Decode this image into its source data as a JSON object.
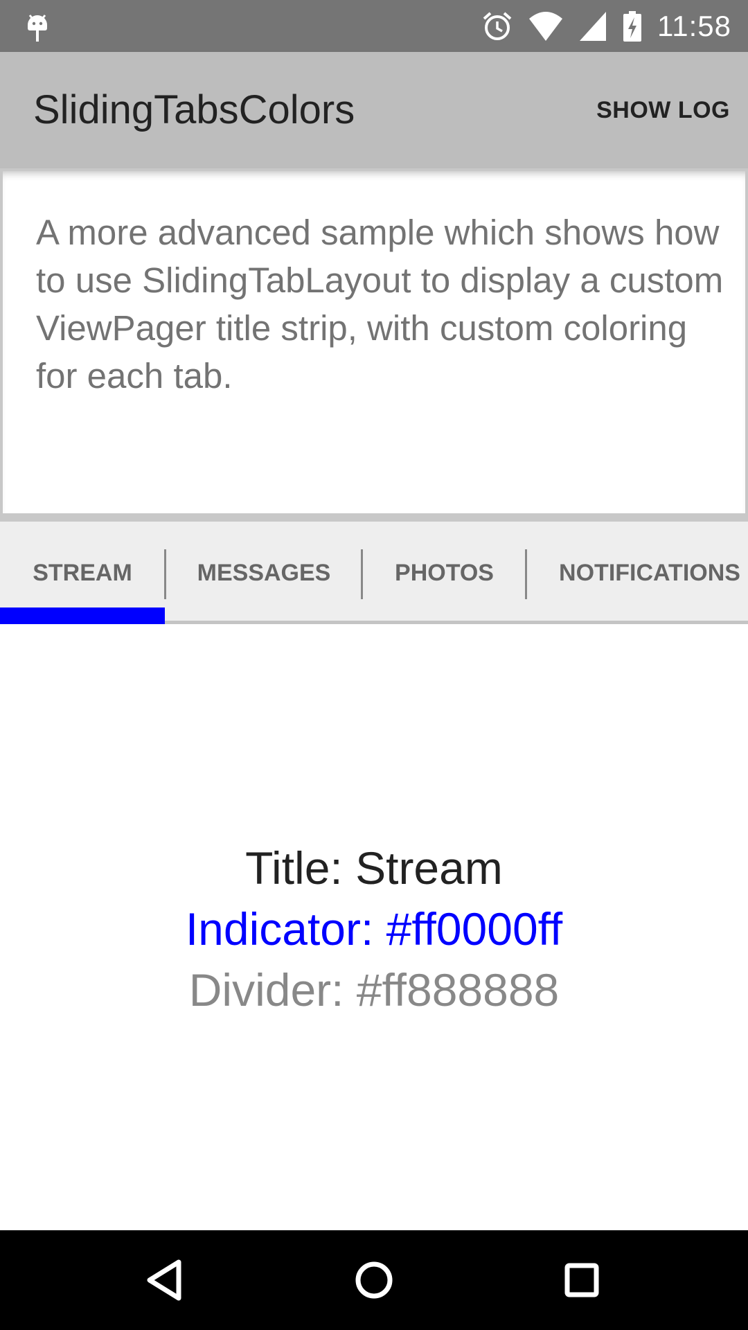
{
  "status_bar": {
    "time": "11:58",
    "icons": [
      "android-debug-icon",
      "alarm-icon",
      "wifi-icon",
      "signal-icon",
      "battery-charging-icon"
    ]
  },
  "app_bar": {
    "title": "SlidingTabsColors",
    "action_label": "SHOW LOG"
  },
  "description": {
    "text": "A more advanced sample which shows how to use SlidingTabLayout to display a custom ViewPager title strip, with custom coloring for each tab."
  },
  "tabs": {
    "items": [
      {
        "label": "STREAM",
        "selected": true
      },
      {
        "label": "MESSAGES",
        "selected": false
      },
      {
        "label": "PHOTOS",
        "selected": false
      },
      {
        "label": "NOTIFICATIONS",
        "selected": false
      }
    ],
    "indicator_color": "#0000ff",
    "divider_color": "#888888"
  },
  "content": {
    "title_line": "Title: Stream",
    "indicator_line": "Indicator: #ff0000ff",
    "divider_line": "Divider: #ff888888"
  },
  "nav_bar": {
    "buttons": [
      "back-icon",
      "home-icon",
      "recents-icon"
    ]
  }
}
